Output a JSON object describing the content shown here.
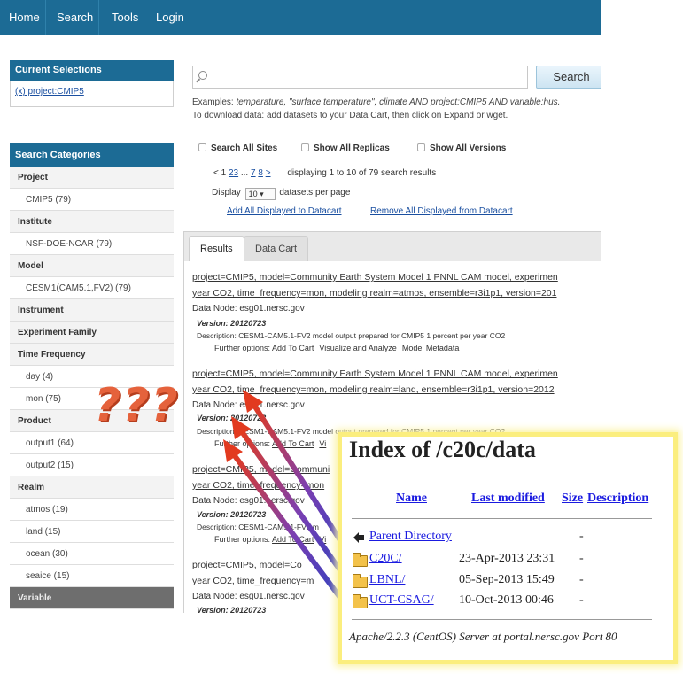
{
  "nav": {
    "items": [
      "Home",
      "Search",
      "Tools",
      "Login"
    ]
  },
  "sidebar": {
    "current_selections_title": "Current Selections",
    "selection": "(x) project:CMIP5",
    "search_categories_title": "Search Categories",
    "categories": [
      {
        "kind": "head",
        "label": "Project"
      },
      {
        "kind": "val",
        "label": "CMIP5 (79)"
      },
      {
        "kind": "head",
        "label": "Institute"
      },
      {
        "kind": "val",
        "label": "NSF-DOE-NCAR (79)"
      },
      {
        "kind": "head",
        "label": "Model"
      },
      {
        "kind": "val",
        "label": "CESM1(CAM5.1,FV2) (79)"
      },
      {
        "kind": "head",
        "label": "Instrument"
      },
      {
        "kind": "head",
        "label": "Experiment Family"
      },
      {
        "kind": "head",
        "label": "Time Frequency"
      },
      {
        "kind": "val",
        "label": "day (4)"
      },
      {
        "kind": "val",
        "label": "mon (75)"
      },
      {
        "kind": "head",
        "label": "Product"
      },
      {
        "kind": "val",
        "label": "output1 (64)"
      },
      {
        "kind": "val",
        "label": "output2 (15)"
      },
      {
        "kind": "head",
        "label": "Realm"
      },
      {
        "kind": "val",
        "label": "atmos (19)"
      },
      {
        "kind": "val",
        "label": "land (15)"
      },
      {
        "kind": "val",
        "label": "ocean (30)"
      },
      {
        "kind": "val",
        "label": "seaice (15)"
      },
      {
        "kind": "dark",
        "label": "Variable"
      }
    ]
  },
  "search": {
    "button": "Search",
    "examples_prefix": "Examples: ",
    "examples_italic": "temperature, \"surface temperature\", climate AND project:CMIP5 AND variable:hus.",
    "download_hint": "To download data: add datasets to your Data Cart, then click on Expand or wget."
  },
  "options": {
    "all_sites": "Search All Sites",
    "all_replicas": "Show All Replicas",
    "all_versions": "Show All Versions"
  },
  "pager": {
    "prev": "< 1",
    "pages": [
      "2",
      "3"
    ],
    "ellipsis": "...",
    "more_pages": [
      "7",
      "8"
    ],
    "next": ">",
    "status": "displaying 1 to 10 of 79 search results"
  },
  "display": {
    "prefix": "Display",
    "value": "10",
    "suffix": "datasets per page"
  },
  "datacart": {
    "add_all": "Add All Displayed to Datacart",
    "remove_all": "Remove All Displayed from Datacart"
  },
  "tabs": {
    "results": "Results",
    "datacart": "Data Cart"
  },
  "results": [
    {
      "line1": "project=CMIP5, model=Community Earth System Model 1 PNNL CAM model, experimen",
      "line2": "year CO2, time_frequency=mon, modeling realm=atmos, ensemble=r3i1p1, version=201",
      "node": "Data Node: esg01.nersc.gov",
      "version": "Version: 20120723",
      "description": "Description: CESM1-CAM5.1-FV2 model output prepared for CMIP5 1 percent per year CO2",
      "options_label": "Further options:",
      "options": [
        "Add To Cart",
        "Visualize and Analyze",
        "Model Metadata"
      ]
    },
    {
      "line1": "project=CMIP5, model=Community Earth System Model 1 PNNL CAM model, experimen",
      "line2": "year CO2, time_frequency=mon, modeling realm=land, ensemble=r3i1p1, version=2012",
      "node": "Data Node: esg01.nersc.gov",
      "version": "Version: 20120723",
      "description": "Description: CESM1-CAM5.1-FV2 model output prepared for CMIP5 1 percent per year CO2",
      "options_label": "Further options:",
      "options": [
        "Add To Cart",
        "Vi"
      ]
    },
    {
      "line1": "project=CMIP5, model=Communi",
      "line2": "year CO2, time_frequency=mon",
      "node": "Data Node: esg01.nersc.gov",
      "version": "Version: 20120723",
      "description": "Description: CESM1-CAM5.1-FV2 m",
      "options_label": "Further options:",
      "options": [
        "Add To Cart",
        "Vi"
      ]
    },
    {
      "line1": "project=CMIP5, model=Co",
      "line2": "year CO2, time_frequency=m",
      "node": "Data Node: esg01.nersc.gov",
      "version": "Version: 20120723"
    }
  ],
  "annotation": {
    "text": "???"
  },
  "index": {
    "title": "Index of /c20c/data",
    "columns": [
      "Name",
      "Last modified",
      "Size",
      "Description"
    ],
    "parent": "Parent Directory",
    "parent_size": "-",
    "rows": [
      {
        "name": "C20C/",
        "modified": "23-Apr-2013 23:31",
        "size": "-"
      },
      {
        "name": "LBNL/",
        "modified": "05-Sep-2013 15:49",
        "size": "-"
      },
      {
        "name": "UCT-CSAG/",
        "modified": "10-Oct-2013 00:46",
        "size": "-"
      }
    ],
    "footer": "Apache/2.2.3 (CentOS) Server at portal.nersc.gov Port 80"
  },
  "colors": {
    "nav": "#1c6b95",
    "arrow_start": "#2c3fbf",
    "arrow_end": "#e23a1f",
    "question": "#e5623c",
    "card_border": "#fbee7e"
  }
}
